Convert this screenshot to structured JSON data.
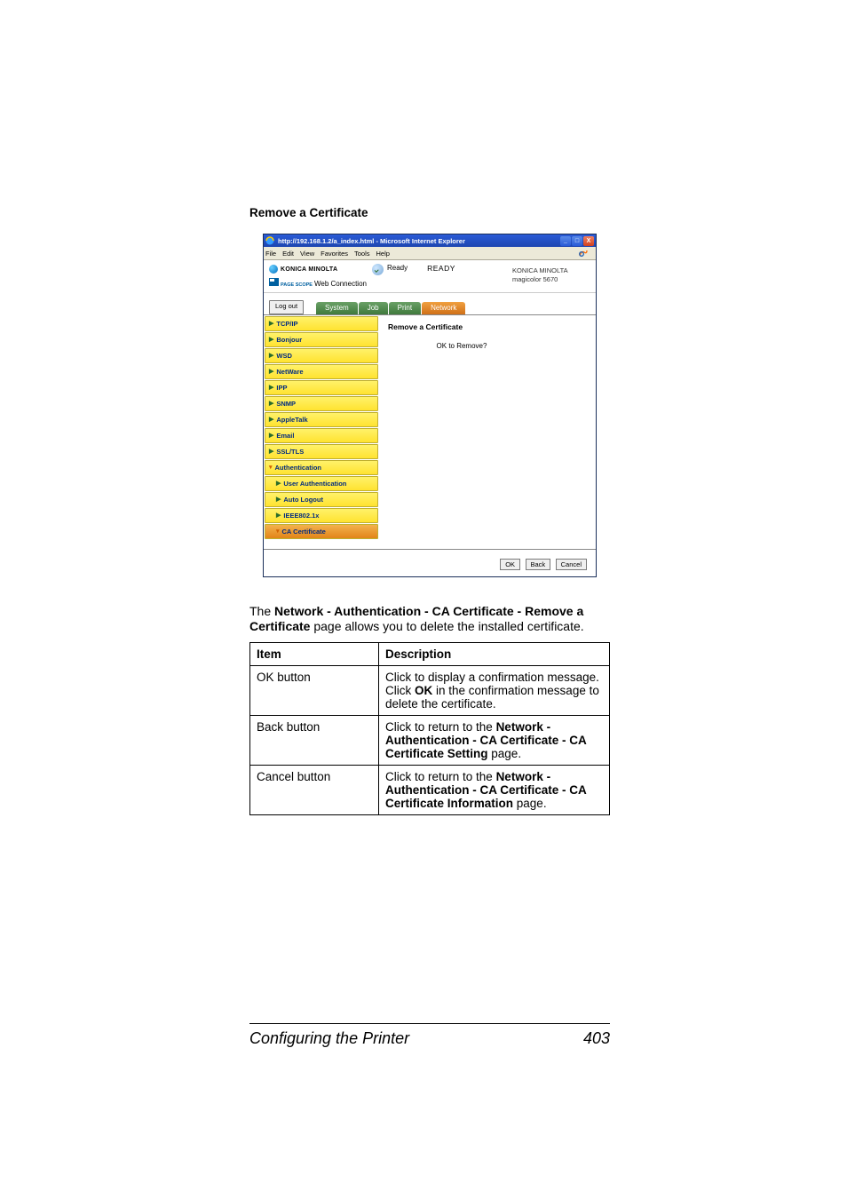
{
  "heading": "Remove a Certificate",
  "browser": {
    "title": "http://192.168.1.2/a_index.html - Microsoft Internet Explorer",
    "menu": {
      "file": "File",
      "edit": "Edit",
      "view": "View",
      "favorites": "Favorites",
      "tools": "Tools",
      "help": "Help"
    },
    "winbtns": {
      "min": "_",
      "max": "□",
      "close": "X"
    }
  },
  "header": {
    "brand": "KONICA MINOLTA",
    "pagescope_small": "PAGE SCOPE",
    "webconn": "Web Connection",
    "ready_label": "Ready",
    "status": "READY",
    "right1": "KONICA MINOLTA",
    "right2": "magicolor 5670"
  },
  "logout": "Log out",
  "tabs": {
    "system": "System",
    "job": "Job",
    "print": "Print",
    "network": "Network"
  },
  "nav": {
    "tcpip": "TCP/IP",
    "bonjour": "Bonjour",
    "wsd": "WSD",
    "netware": "NetWare",
    "ipp": "IPP",
    "snmp": "SNMP",
    "appletalk": "AppleTalk",
    "email": "Email",
    "ssltls": "SSL/TLS",
    "auth": "Authentication",
    "userauth": "User Authentication",
    "autologout": "Auto Logout",
    "ieee": "IEEE802.1x",
    "cacert": "CA Certificate"
  },
  "content": {
    "title": "Remove a Certificate",
    "msg": "OK to Remove?"
  },
  "btnbar": {
    "ok": "OK",
    "back": "Back",
    "cancel": "Cancel"
  },
  "body_para_pre": "The ",
  "body_para_bold": "Network - Authentication - CA Certificate - Remove a Certificate",
  "body_para_post": " page allows you to delete the installed certificate.",
  "table": {
    "h_item": "Item",
    "h_desc": "Description",
    "rows": [
      {
        "item": "OK button",
        "desc_pre": "Click to display a confirmation message. Click ",
        "desc_b1": "OK",
        "desc_mid": " in the confirmation message to delete the certificate.",
        "desc_b2": "",
        "desc_post": ""
      },
      {
        "item": "Back button",
        "desc_pre": "Click to return to the ",
        "desc_b1": "Network - Authentication - CA Certificate - CA Certificate Setting",
        "desc_mid": " page.",
        "desc_b2": "",
        "desc_post": ""
      },
      {
        "item": "Cancel button",
        "desc_pre": "Click to return to the ",
        "desc_b1": "Network - Authentication - CA Certificate - CA Certificate Information",
        "desc_mid": " page.",
        "desc_b2": "",
        "desc_post": ""
      }
    ]
  },
  "footer": {
    "title": "Configuring the Printer",
    "page": "403"
  }
}
